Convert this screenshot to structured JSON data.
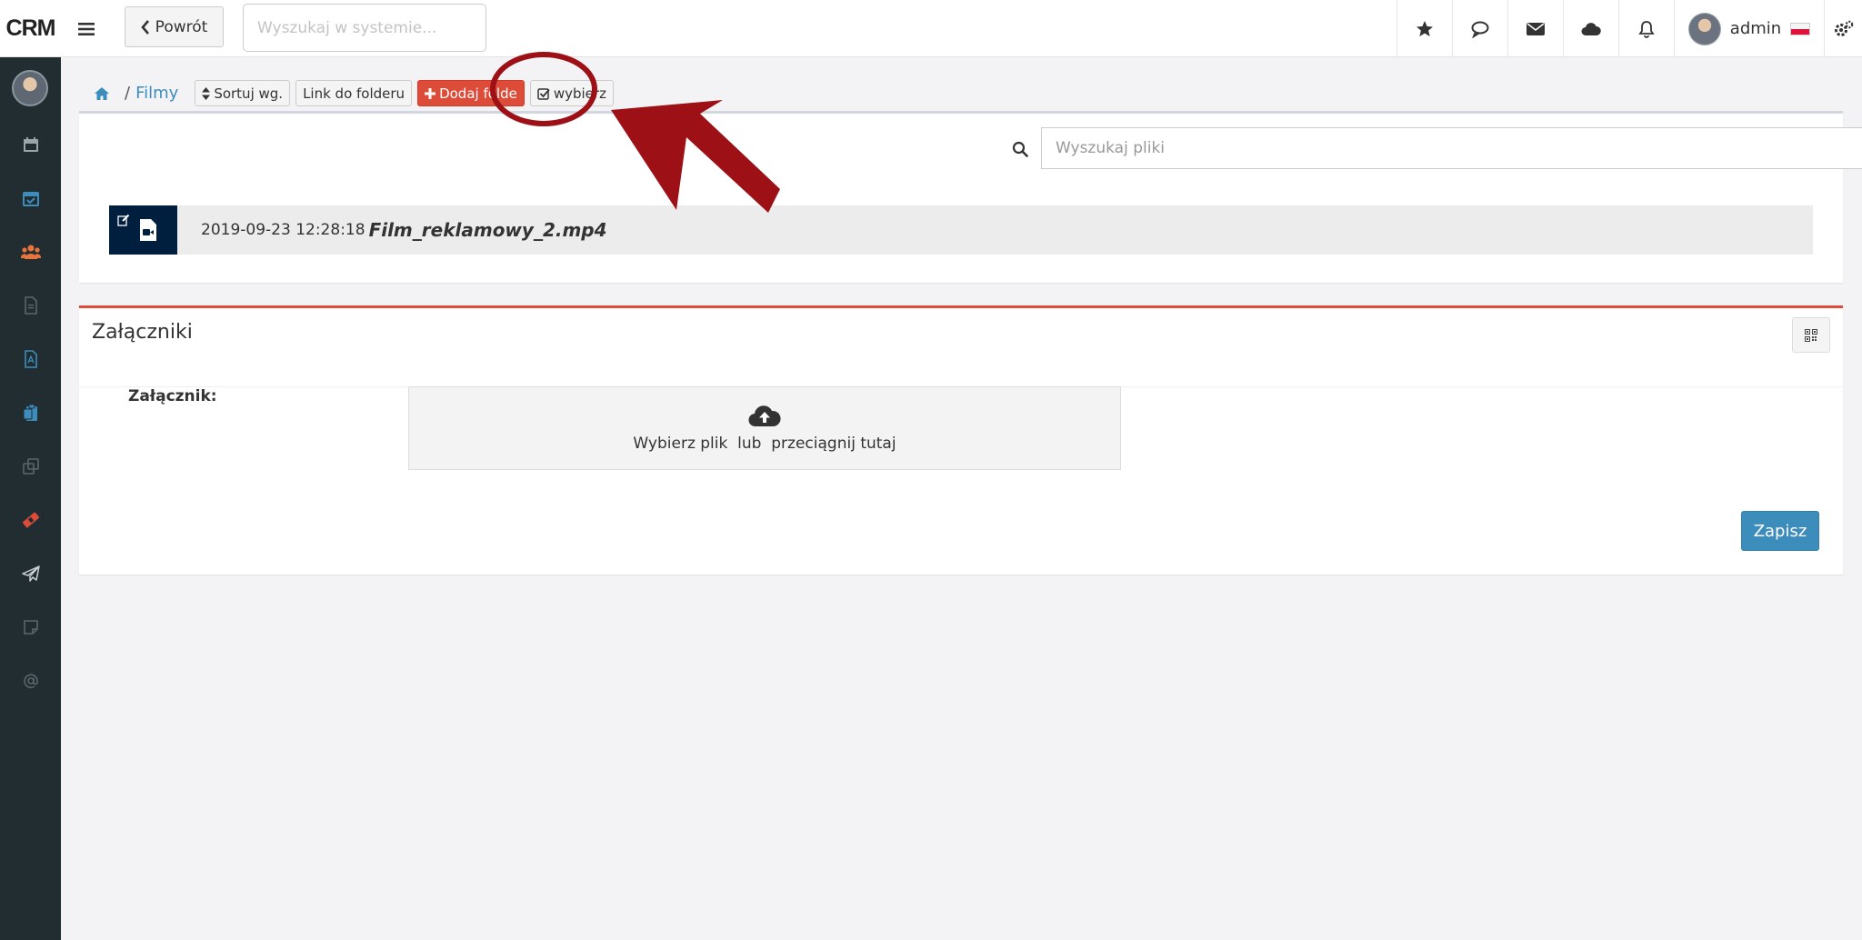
{
  "app": {
    "brand": "CRM"
  },
  "header": {
    "back_label": "Powrót",
    "search_placeholder": "Wyszukaj w systemie...",
    "user_name": "admin"
  },
  "breadcrumb": {
    "folder": "Filmy",
    "separator": "/"
  },
  "toolbar": {
    "sort_label": "Sortuj wg.",
    "link_label": "Link do folderu",
    "add_folder_label": "Dodaj folde",
    "select_label": "wybierz"
  },
  "files": {
    "search_placeholder": "Wyszukaj pliki",
    "items": [
      {
        "datetime": "2019-09-23 12:28:18",
        "name": "Film_reklamowy_2.mp4"
      }
    ]
  },
  "attachments": {
    "title": "Załączniki",
    "field_label": "Załącznik:",
    "dropzone_text": "Wybierz plik  lub  przeciągnij tutaj",
    "save_label": "Zapisz"
  },
  "colors": {
    "sidebar_bg": "#222d32",
    "link_blue": "#3c8dbc",
    "danger_red": "#dd4b39",
    "file_icon_bg": "#001f3f",
    "annotation_red": "#9c1016"
  },
  "icons": {
    "header": [
      "star-icon",
      "comments-icon",
      "envelope-icon",
      "cloud-icon",
      "bell-icon",
      "cogs-icon"
    ],
    "sidebar": [
      "calendar-icon",
      "calendar-check-icon",
      "users-icon",
      "file-icon",
      "file-pdf-icon",
      "clipboard-icon",
      "clone-icon",
      "ticket-icon",
      "paper-plane-icon",
      "note-icon",
      "at-icon"
    ]
  }
}
